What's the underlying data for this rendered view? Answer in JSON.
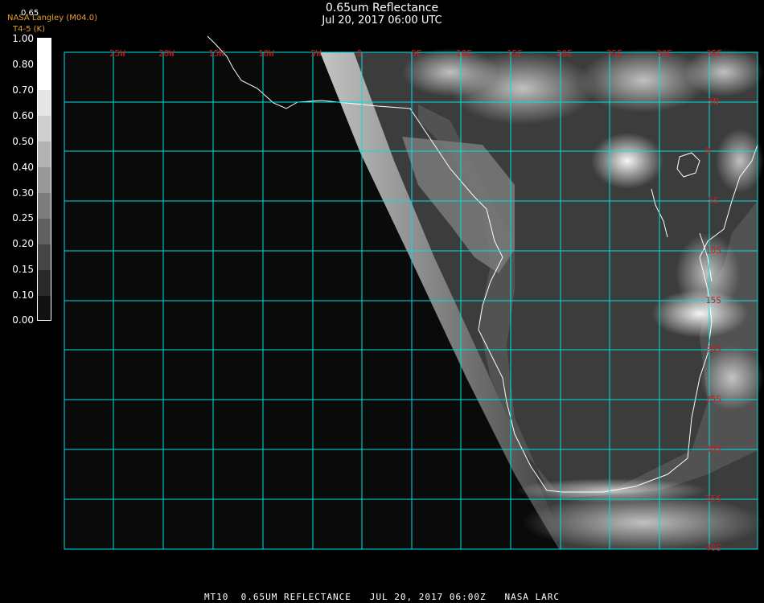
{
  "header": {
    "title": "0.65um Reflectance",
    "datetime": "Jul 20, 2017 06:00 UTC",
    "credit_line1": "NASA Langley (M04.0)",
    "credit_line2": "T4-5 (K)",
    "scale_top": "0.65"
  },
  "colorbar": {
    "labels": [
      "1.00",
      "0.80",
      "0.70",
      "0.60",
      "0.50",
      "0.40",
      "0.30",
      "0.25",
      "0.20",
      "0.15",
      "0.10",
      "0.00"
    ],
    "grid_color": "#00e0e0",
    "label_color": "#cc2020"
  },
  "map": {
    "lon_labels": [
      "25W",
      "20W",
      "15W",
      "10W",
      "5W",
      "0",
      "5E",
      "10E",
      "15E",
      "20E",
      "25E",
      "30E",
      "35E"
    ],
    "lat_labels": [
      "5N",
      "0",
      "5S",
      "10S",
      "15S",
      "20S",
      "25S",
      "30S",
      "35S",
      "40S"
    ]
  },
  "footer": {
    "text": "MT10  0.65UM REFLECTANCE   JUL 20, 2017 06:00Z   NASA LARC"
  }
}
